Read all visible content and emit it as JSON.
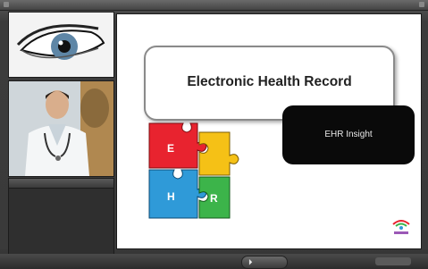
{
  "app": {
    "title": "Electronic Health Record",
    "brand": ""
  },
  "thumbnails": [
    {
      "name": "eye",
      "icon": "eye-image"
    },
    {
      "name": "doctor",
      "icon": "doctor-image"
    }
  ],
  "panel": {
    "tabs": [
      "",
      ""
    ],
    "outline_items": [
      "",
      "",
      "",
      "",
      "",
      "",
      "",
      ""
    ]
  },
  "slide": {
    "title": "Electronic Health Record",
    "insight_label": "EHR Insight",
    "puzzle_letters": [
      "E",
      "H",
      "R",
      "",
      ""
    ],
    "colors": {
      "red": "#e8232f",
      "yellow": "#f5c116",
      "green": "#3cb44a",
      "blue": "#2f9ad8",
      "black_box": "#0a0a0a"
    }
  },
  "controls": {
    "play_icon": "play-icon",
    "play_label": ""
  }
}
